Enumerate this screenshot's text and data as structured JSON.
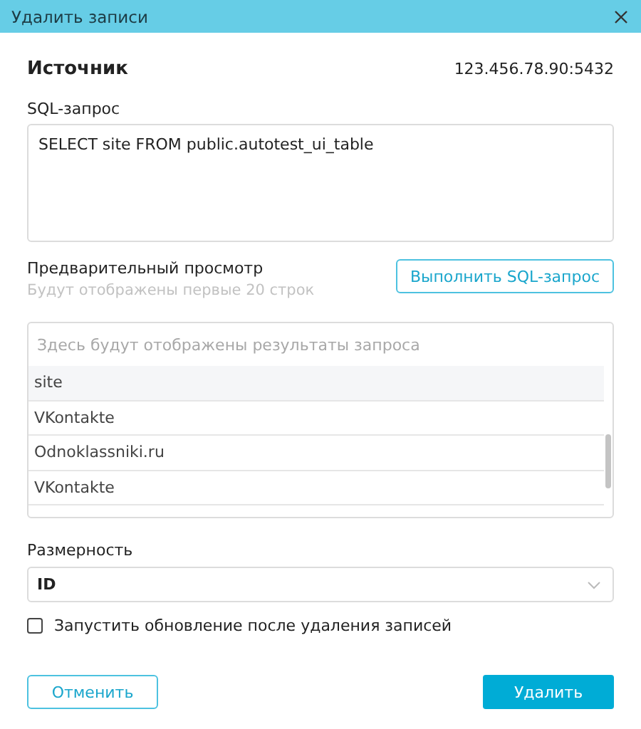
{
  "window": {
    "title": "Удалить записи"
  },
  "source": {
    "label": "Источник",
    "address": "123.456.78.90:5432"
  },
  "sql": {
    "label": "SQL-запрос",
    "value": "SELECT site FROM public.autotest_ui_table"
  },
  "preview": {
    "title": "Предварительный просмотр",
    "hint": "Будут отображены первые 20 строк",
    "run_button": "Выполнить SQL-запрос",
    "placeholder": "Здесь будут отображены результаты запроса",
    "column": "site",
    "rows": [
      "VKontakte",
      "Odnoklassniki.ru",
      "VKontakte"
    ]
  },
  "dimension": {
    "label": "Размерность",
    "value": "ID"
  },
  "refresh": {
    "label": "Запустить обновление после удаления записей",
    "checked": false
  },
  "buttons": {
    "cancel": "Отменить",
    "delete": "Удалить"
  }
}
